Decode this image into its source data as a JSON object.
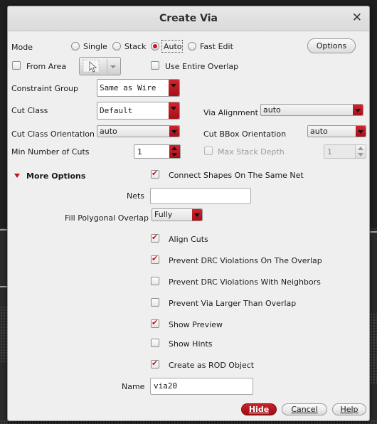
{
  "dialog": {
    "title": "Create Via",
    "close_glyph": "✕"
  },
  "mode": {
    "label": "Mode",
    "options": [
      {
        "label": "Single",
        "selected": false
      },
      {
        "label": "Stack",
        "selected": false
      },
      {
        "label": "Auto",
        "selected": true
      },
      {
        "label": "Fast Edit",
        "selected": false
      }
    ],
    "options_button": "Options"
  },
  "from_area": {
    "label": "From Area",
    "checked": false
  },
  "use_entire_overlap": {
    "label": "Use Entire Overlap",
    "checked": false
  },
  "area_picker": {
    "icon": "pointer-icon"
  },
  "constraint_group": {
    "label": "Constraint Group",
    "value": "Same as Wire"
  },
  "cut_class": {
    "label": "Cut Class",
    "value": "Default"
  },
  "via_alignment": {
    "label": "Via Alignment",
    "value": "auto"
  },
  "cut_class_orientation": {
    "label": "Cut Class Orientation",
    "value": "auto"
  },
  "cut_bbox_orientation": {
    "label": "Cut BBox Orientation",
    "value": "auto"
  },
  "min_number_of_cuts": {
    "label": "Min Number of Cuts",
    "value": "1"
  },
  "max_stack_depth": {
    "label": "Max Stack Depth",
    "value": "1",
    "checked": false,
    "enabled": false
  },
  "more_options": {
    "label": "More Options",
    "expanded": true,
    "connect_shapes": {
      "label": "Connect Shapes On The Same Net",
      "checked": true
    },
    "nets": {
      "label": "Nets",
      "value": ""
    },
    "fill_polygonal_overlap": {
      "label": "Fill Polygonal Overlap",
      "value": "Fully"
    },
    "checkboxes": [
      {
        "label": "Align Cuts",
        "checked": true
      },
      {
        "label": "Prevent DRC Violations On The Overlap",
        "checked": true
      },
      {
        "label": "Prevent DRC Violations With Neighbors",
        "checked": false
      },
      {
        "label": "Prevent Via Larger Than Overlap",
        "checked": false
      },
      {
        "label": "Show Preview",
        "checked": true
      },
      {
        "label": "Show Hints",
        "checked": false
      },
      {
        "label": "Create as ROD Object",
        "checked": true
      }
    ],
    "name": {
      "label": "Name",
      "value": "via20"
    }
  },
  "buttons": {
    "hide": "Hide",
    "cancel": "Cancel",
    "help": "Help"
  },
  "colors": {
    "accent": "#c4141c",
    "dialog_bg": "#efefef",
    "backdrop": "#1f1f1f"
  }
}
